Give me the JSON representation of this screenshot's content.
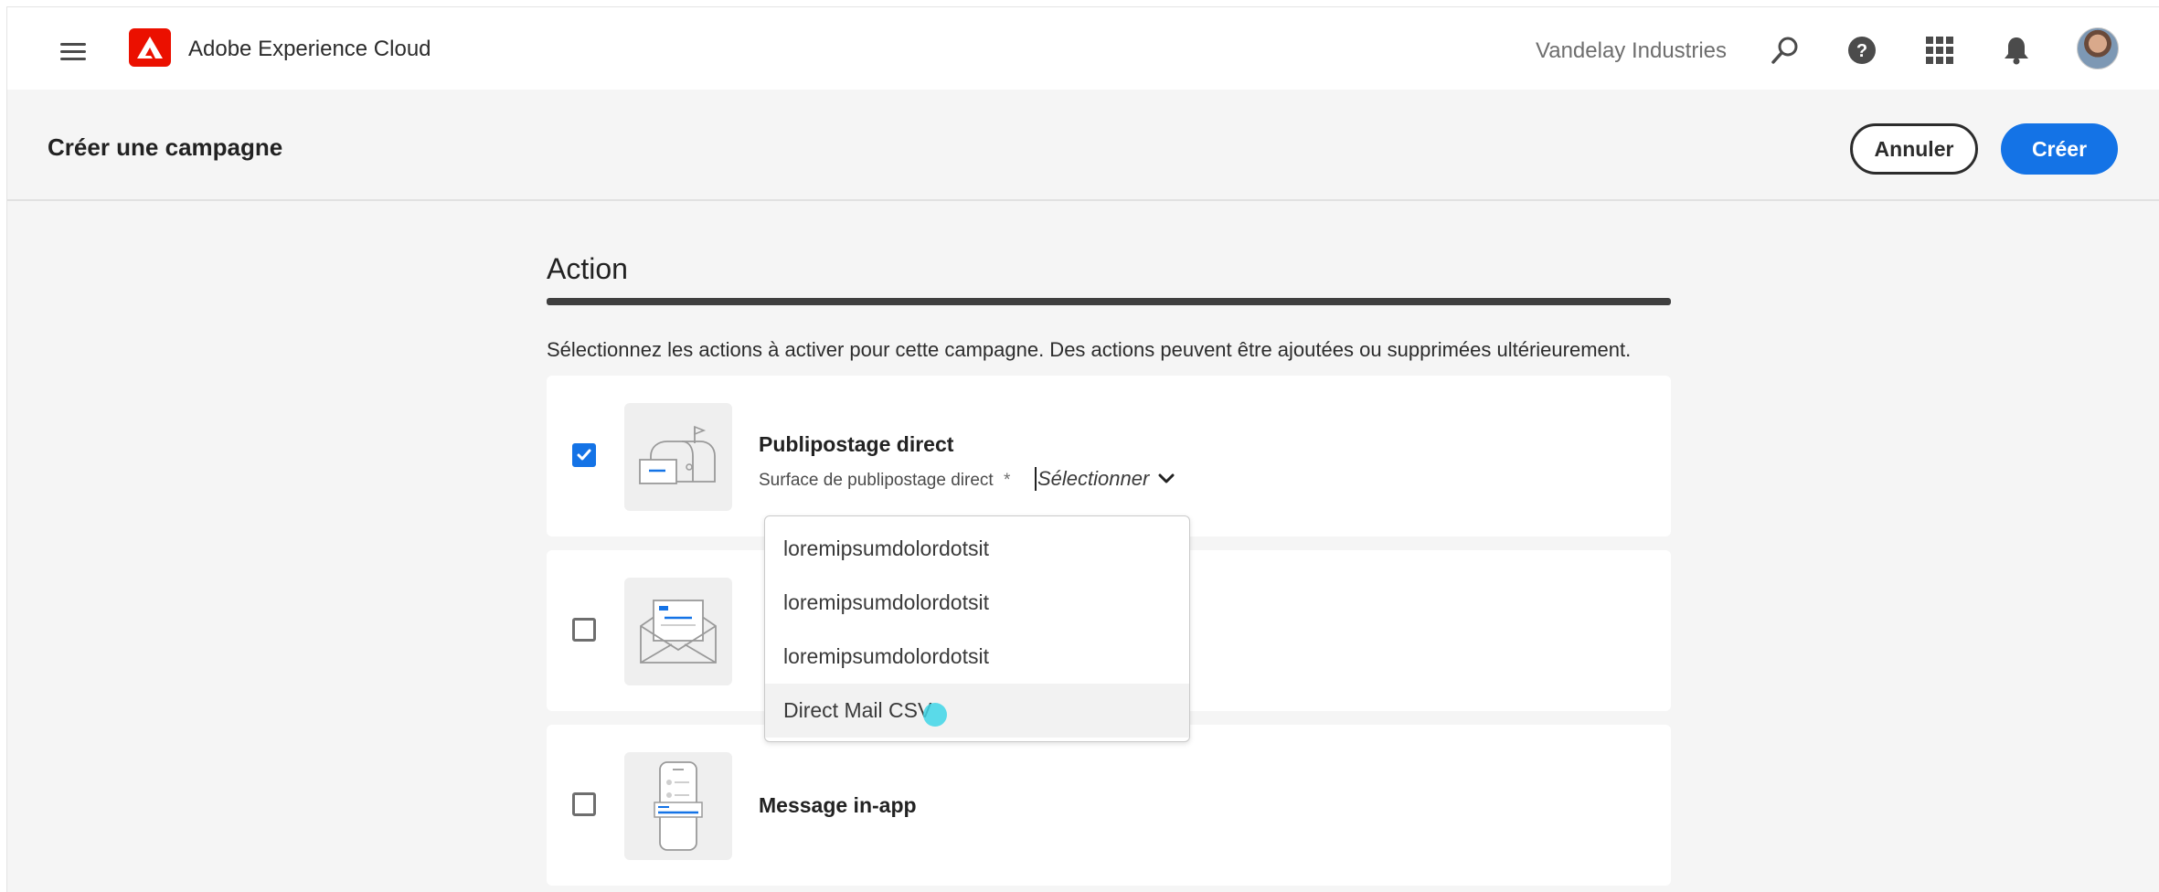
{
  "shell": {
    "app_title": "Adobe Experience Cloud",
    "org_name": "Vandelay Industries",
    "icons": [
      "menu-icon",
      "adobe-logo",
      "search-icon",
      "help-icon",
      "apps-grid-icon",
      "notifications-bell-icon",
      "user-avatar"
    ],
    "brand_color": "#eb1000"
  },
  "header": {
    "title": "Créer une campagne",
    "cancel_label": "Annuler",
    "create_label": "Créer",
    "accent_color": "#1473e6"
  },
  "action": {
    "title": "Action",
    "description": "Sélectionnez les actions à activer pour cette campagne. Des actions peuvent être ajoutées ou supprimées ultérieurement.",
    "cards": [
      {
        "title": "Publipostage direct",
        "checked": true,
        "icon": "mailbox-icon",
        "field_label": "Surface de publipostage direct",
        "required_mark": "*",
        "select_placeholder": "Sélectionner"
      },
      {
        "title": "",
        "checked": false,
        "icon": "email-envelope-icon"
      },
      {
        "title": "Message in-app",
        "checked": false,
        "icon": "mobile-phone-icon"
      }
    ]
  },
  "dropdown": {
    "options": [
      "loremipsumdolordotsit",
      "loremipsumdolordotsit",
      "loremipsumdolordotsit",
      "Direct Mail CSV"
    ],
    "hovered_index": 3
  }
}
